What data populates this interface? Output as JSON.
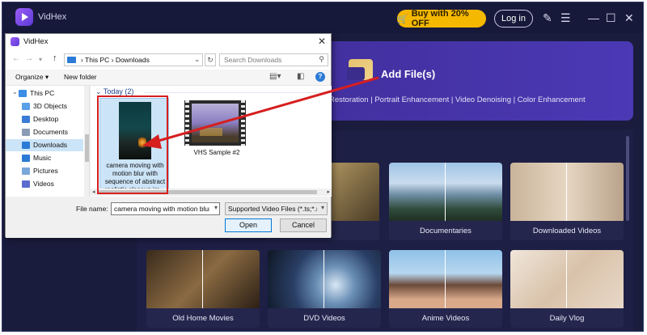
{
  "app": {
    "title": "VidHex",
    "buy_label": "Buy with 20% OFF",
    "login_label": "Log in",
    "add_files_label": "Add File(s)",
    "features_text": "Restoration | Portrait Enhancement | Video Denoising | Color Enhancement",
    "cards": [
      {
        "label": "Documentaries"
      },
      {
        "label": "Downloaded Videos"
      },
      {
        "label": "Old Home Movies"
      },
      {
        "label": "DVD Videos"
      },
      {
        "label": "Anime Videos"
      },
      {
        "label": "Daily Vlog"
      }
    ]
  },
  "dialog": {
    "title": "VidHex",
    "breadcrumb": "›  This PC  ›  Downloads",
    "search_placeholder": "Search Downloads",
    "organize_label": "Organize ▾",
    "new_folder_label": "New folder",
    "nav_items": [
      {
        "label": "This PC",
        "icon": "computer-icon",
        "color": "#3a8ee6"
      },
      {
        "label": "3D Objects",
        "icon": "cube-icon",
        "color": "#5aa0e8"
      },
      {
        "label": "Desktop",
        "icon": "desktop-icon",
        "color": "#3a7bd5"
      },
      {
        "label": "Documents",
        "icon": "document-icon",
        "color": "#8a9bb5"
      },
      {
        "label": "Downloads",
        "icon": "download-icon",
        "color": "#2b7bd6"
      },
      {
        "label": "Music",
        "icon": "music-icon",
        "color": "#2b7bd6"
      },
      {
        "label": "Pictures",
        "icon": "pictures-icon",
        "color": "#7aa7d9"
      },
      {
        "label": "Videos",
        "icon": "videos-icon",
        "color": "#5b6ccf"
      }
    ],
    "group_header": "Today (2)",
    "files": [
      {
        "name": "camera moving with motion blur with sequence of abstract realistic closeup im..."
      },
      {
        "name": "VHS Sample #2"
      }
    ],
    "file_name_label": "File name:",
    "file_name_value": "camera moving with motion blur",
    "filter_value": "Supported Video Files (*.ts;*.mt",
    "open_label": "Open",
    "cancel_label": "Cancel"
  },
  "colors": {
    "app_bg": "#1a1c3e",
    "banner": "#4b39b5",
    "buy_button": "#f5b800",
    "annotation": "#d61f1f",
    "selection": "#cce4f7"
  }
}
